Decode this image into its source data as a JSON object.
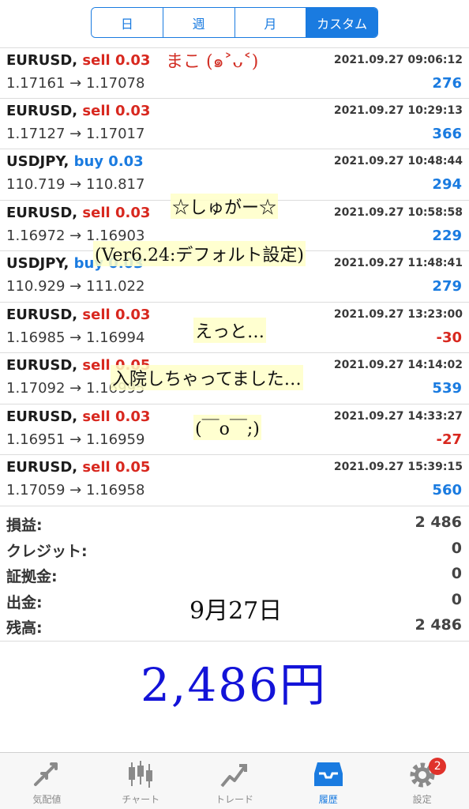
{
  "period_tabs": [
    {
      "label": "日",
      "active": false
    },
    {
      "label": "週",
      "active": false
    },
    {
      "label": "月",
      "active": false
    },
    {
      "label": "カスタム",
      "active": true
    }
  ],
  "arrow": "→",
  "trades": [
    {
      "symbol": "EURUSD,",
      "side": "sell 0.03",
      "type": "sell",
      "datetime": "2021.09.27 09:06:12",
      "open": "1.17161",
      "close": "1.17078",
      "profit": "276",
      "sign": "pos"
    },
    {
      "symbol": "EURUSD,",
      "side": "sell 0.03",
      "type": "sell",
      "datetime": "2021.09.27 10:29:13",
      "open": "1.17127",
      "close": "1.17017",
      "profit": "366",
      "sign": "pos"
    },
    {
      "symbol": "USDJPY,",
      "side": "buy 0.03",
      "type": "buy",
      "datetime": "2021.09.27 10:48:44",
      "open": "110.719",
      "close": "110.817",
      "profit": "294",
      "sign": "pos"
    },
    {
      "symbol": "EURUSD,",
      "side": "sell 0.03",
      "type": "sell",
      "datetime": "2021.09.27 10:58:58",
      "open": "1.16972",
      "close": "1.16903",
      "profit": "229",
      "sign": "pos"
    },
    {
      "symbol": "USDJPY,",
      "side": "buy 0.03",
      "type": "buy",
      "datetime": "2021.09.27 11:48:41",
      "open": "110.929",
      "close": "111.022",
      "profit": "279",
      "sign": "pos"
    },
    {
      "symbol": "EURUSD,",
      "side": "sell 0.03",
      "type": "sell",
      "datetime": "2021.09.27 13:23:00",
      "open": "1.16985",
      "close": "1.16994",
      "profit": "-30",
      "sign": "neg"
    },
    {
      "symbol": "EURUSD,",
      "side": "sell 0.05",
      "type": "sell",
      "datetime": "2021.09.27 14:14:02",
      "open": "1.17092",
      "close": "1.16995",
      "profit": "539",
      "sign": "pos"
    },
    {
      "symbol": "EURUSD,",
      "side": "sell 0.03",
      "type": "sell",
      "datetime": "2021.09.27 14:33:27",
      "open": "1.16951",
      "close": "1.16959",
      "profit": "-27",
      "sign": "neg"
    },
    {
      "symbol": "EURUSD,",
      "side": "sell 0.05",
      "type": "sell",
      "datetime": "2021.09.27 15:39:15",
      "open": "1.17059",
      "close": "1.16958",
      "profit": "560",
      "sign": "pos"
    }
  ],
  "summary": [
    {
      "label": "損益:",
      "value": "2 486"
    },
    {
      "label": "クレジット:",
      "value": "0"
    },
    {
      "label": "証拠金:",
      "value": "0"
    },
    {
      "label": "出金:",
      "value": "0"
    },
    {
      "label": "残高:",
      "value": "2 486"
    }
  ],
  "annotations": {
    "mako": "まこ (๑˃ᴗ˂)",
    "title": "☆しゅがー☆",
    "version": "(Ver6.24:デフォルト設定)",
    "etto": "えっと…",
    "nyuin": "入院しちゃってました…",
    "face": "(￣o￣;)",
    "date": "9月27日",
    "yen": "2,486円"
  },
  "tabs": [
    {
      "label": "気配値",
      "icon": "quotes-arrows-icon",
      "active": false
    },
    {
      "label": "チャート",
      "icon": "candlestick-chart-icon",
      "active": false
    },
    {
      "label": "トレード",
      "icon": "trade-trend-icon",
      "active": false
    },
    {
      "label": "履歴",
      "icon": "history-inbox-icon",
      "active": true
    },
    {
      "label": "設定",
      "icon": "settings-gear-icon",
      "active": false,
      "badge": "2"
    }
  ],
  "colors": {
    "accent": "#1a7be0",
    "sell": "#d8281f",
    "buy": "#1a7be0",
    "badge": "#e0322b",
    "handwriting_red": "#d22f25",
    "handwriting_blue": "#1313d8"
  }
}
